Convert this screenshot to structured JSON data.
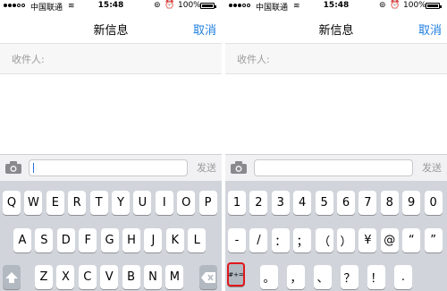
{
  "status_bar": {
    "carrier": "中国联通",
    "time": "15:48",
    "battery_percent": "100%"
  },
  "navbar": {
    "title": "新信息",
    "cancel_label": "取消"
  },
  "recipient": {
    "label": "收件人:"
  },
  "compose": {
    "send_label": "发送"
  },
  "keyboard_letters": {
    "row1": [
      "Q",
      "W",
      "E",
      "R",
      "T",
      "Y",
      "U",
      "I",
      "O",
      "P"
    ],
    "row2": [
      "A",
      "S",
      "D",
      "F",
      "G",
      "H",
      "J",
      "K",
      "L"
    ],
    "row3": [
      "Z",
      "X",
      "C",
      "V",
      "B",
      "N",
      "M"
    ]
  },
  "keyboard_numbers": {
    "row1": [
      "1",
      "2",
      "3",
      "4",
      "5",
      "6",
      "7",
      "8",
      "9",
      "0"
    ],
    "row2": [
      "-",
      "/",
      "：",
      "；",
      "（",
      "）",
      "¥",
      "@",
      "“",
      "”"
    ],
    "row3_mode_label": "#+=",
    "row3": [
      "。",
      "，",
      "、",
      "？",
      "！",
      "."
    ]
  }
}
